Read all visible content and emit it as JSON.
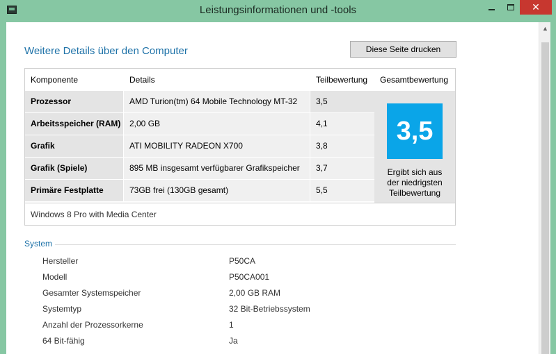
{
  "window": {
    "title": "Leistungsinformationen und -tools",
    "close_label": "✕"
  },
  "page": {
    "heading": "Weitere Details über den Computer",
    "print_button": "Diese Seite drucken"
  },
  "table": {
    "headers": {
      "component": "Komponente",
      "details": "Details",
      "subscore": "Teilbewertung",
      "overall": "Gesamtbewertung"
    },
    "rows": [
      {
        "component": "Prozessor",
        "details": "AMD Turion(tm) 64 Mobile Technology MT-32",
        "subscore": "3,5"
      },
      {
        "component": "Arbeitsspeicher (RAM)",
        "details": "2,00 GB",
        "subscore": "4,1"
      },
      {
        "component": "Grafik",
        "details": "ATI MOBILITY RADEON X700",
        "subscore": "3,8"
      },
      {
        "component": "Grafik (Spiele)",
        "details": "895 MB insgesamt verfügbarer Grafikspeicher",
        "subscore": "3,7"
      },
      {
        "component": "Primäre Festplatte",
        "details": "73GB frei (130GB gesamt)",
        "subscore": "5,5"
      }
    ],
    "overall_score": "3,5",
    "overall_note_1": "Ergibt sich aus",
    "overall_note_2": "der niedrigsten",
    "overall_note_3": "Teilbewertung",
    "edition": "Windows 8 Pro with Media Center"
  },
  "system": {
    "title": "System",
    "properties": [
      {
        "label": "Hersteller",
        "value": "P50CA"
      },
      {
        "label": "Modell",
        "value": "P50CA001"
      },
      {
        "label": "Gesamter Systemspeicher",
        "value": "2,00 GB RAM"
      },
      {
        "label": "Systemtyp",
        "value": "32 Bit-Betriebssystem"
      },
      {
        "label": "Anzahl der Prozessorkerne",
        "value": "1"
      },
      {
        "label": "64 Bit-fähig",
        "value": "Ja"
      }
    ]
  },
  "colors": {
    "titlebar": "#86c7a3",
    "accent": "#1e72a8",
    "score_tile": "#0aa5e8",
    "close_button": "#c7372f"
  }
}
